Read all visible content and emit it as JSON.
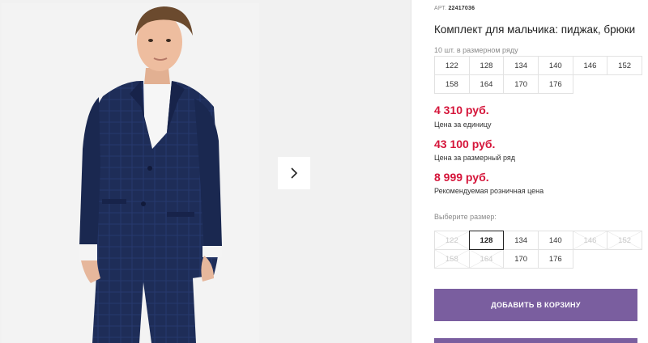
{
  "product": {
    "sku_label": "АРТ.",
    "sku_value": "22417036",
    "title": "Комплект для мальчика: пиджак, брюки",
    "range_label": "10 шт. в размерном ряду",
    "range_sizes": [
      "122",
      "128",
      "134",
      "140",
      "146",
      "152",
      "158",
      "164",
      "170",
      "176"
    ],
    "prices": [
      {
        "amount": "4 310 руб.",
        "note": "Цена за единицу"
      },
      {
        "amount": "43 100 руб.",
        "note": "Цена за размерный ряд"
      },
      {
        "amount": "8 999 руб.",
        "note": "Рекомендуемая розничная цена"
      }
    ],
    "choose_size_label": "Выберите размер:",
    "select_sizes": [
      {
        "label": "122",
        "state": "disabled"
      },
      {
        "label": "128",
        "state": "selected"
      },
      {
        "label": "134",
        "state": "available"
      },
      {
        "label": "140",
        "state": "available"
      },
      {
        "label": "146",
        "state": "disabled"
      },
      {
        "label": "152",
        "state": "disabled"
      },
      {
        "label": "158",
        "state": "disabled"
      },
      {
        "label": "164",
        "state": "disabled"
      },
      {
        "label": "170",
        "state": "available"
      },
      {
        "label": "176",
        "state": "available"
      }
    ],
    "add_to_cart_label": "ДОБАВИТЬ В КОРЗИНУ"
  },
  "gallery": {
    "next_icon": "chevron-right-icon"
  },
  "colors": {
    "price": "#d5153a",
    "button": "#7a5e9f",
    "suit": "#1d2b56"
  }
}
